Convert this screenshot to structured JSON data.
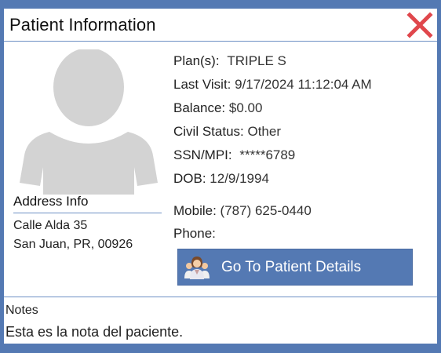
{
  "dialog": {
    "title": "Patient Information",
    "close_icon": "close-x-icon"
  },
  "avatar": {
    "icon": "person-silhouette-icon",
    "color": "#d3d3d3"
  },
  "address": {
    "title": "Address Info",
    "line1": "Calle Alda 35",
    "line2": "San Juan, PR, 00926"
  },
  "info": {
    "plans_label": "Plan(s):",
    "plans_value": "TRIPLE S",
    "last_visit_label": "Last Visit:",
    "last_visit_value": "9/17/2024 11:12:04 AM",
    "balance_label": "Balance:",
    "balance_value": "$0.00",
    "civil_status_label": "Civil Status:",
    "civil_status_value": "Other",
    "ssn_label": "SSN/MPI:",
    "ssn_value": "*****6789",
    "dob_label": "DOB:",
    "dob_value": "12/9/1994",
    "mobile_label": "Mobile:",
    "mobile_value": "(787) 625-0440",
    "phone_label": "Phone:",
    "phone_value": ""
  },
  "go_button": {
    "label": "Go To Patient Details",
    "icon": "patients-group-icon"
  },
  "notes": {
    "title": "Notes",
    "text": "Esta es la nota del paciente."
  },
  "colors": {
    "frame": "#5479b3",
    "accent_rule": "#6d8fc4",
    "close_red": "#e0474c",
    "button_bg": "#5479b3"
  }
}
